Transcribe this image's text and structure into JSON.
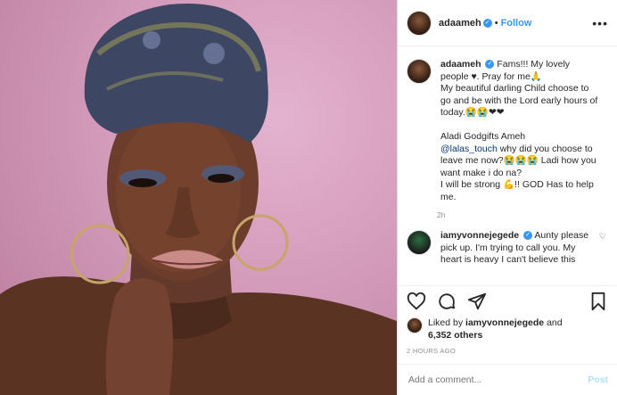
{
  "header": {
    "username": "adaameh",
    "verified_mark": "✓",
    "separator": "•",
    "follow_label": "Follow",
    "more_label": "•••"
  },
  "caption": {
    "username": "adaameh",
    "verified_mark": "✓",
    "line1": " Fams!!! My lovely people ♥. Pray for me🙏",
    "line2": "My beautiful darling Child choose to go and be with the Lord early hours of today.😭😭❤❤",
    "line3": "Aladi Godgifts Ameh",
    "mention": "@lalas_touch",
    "line4": " why did you choose to leave me now?😭😭😭 Ladi how you want make i do na?",
    "line5": "I will be strong 💪!! GOD Has to help me.",
    "time": "2h"
  },
  "comment": {
    "username": "iamyvonnejegede",
    "verified_mark": "✓",
    "text": " Aunty please pick up. I'm trying to call you. My heart is heavy I can't believe this",
    "heart": "♡"
  },
  "likes": {
    "prefix": "Liked by ",
    "user": "iamyvonnejegede",
    "middle": " and",
    "count": "6,352 others"
  },
  "posted_ago": "2 HOURS AGO",
  "add_comment": {
    "placeholder": "Add a comment...",
    "post_label": "Post"
  },
  "icons": [
    "heart-icon",
    "comment-icon",
    "share-icon",
    "bookmark-icon"
  ]
}
